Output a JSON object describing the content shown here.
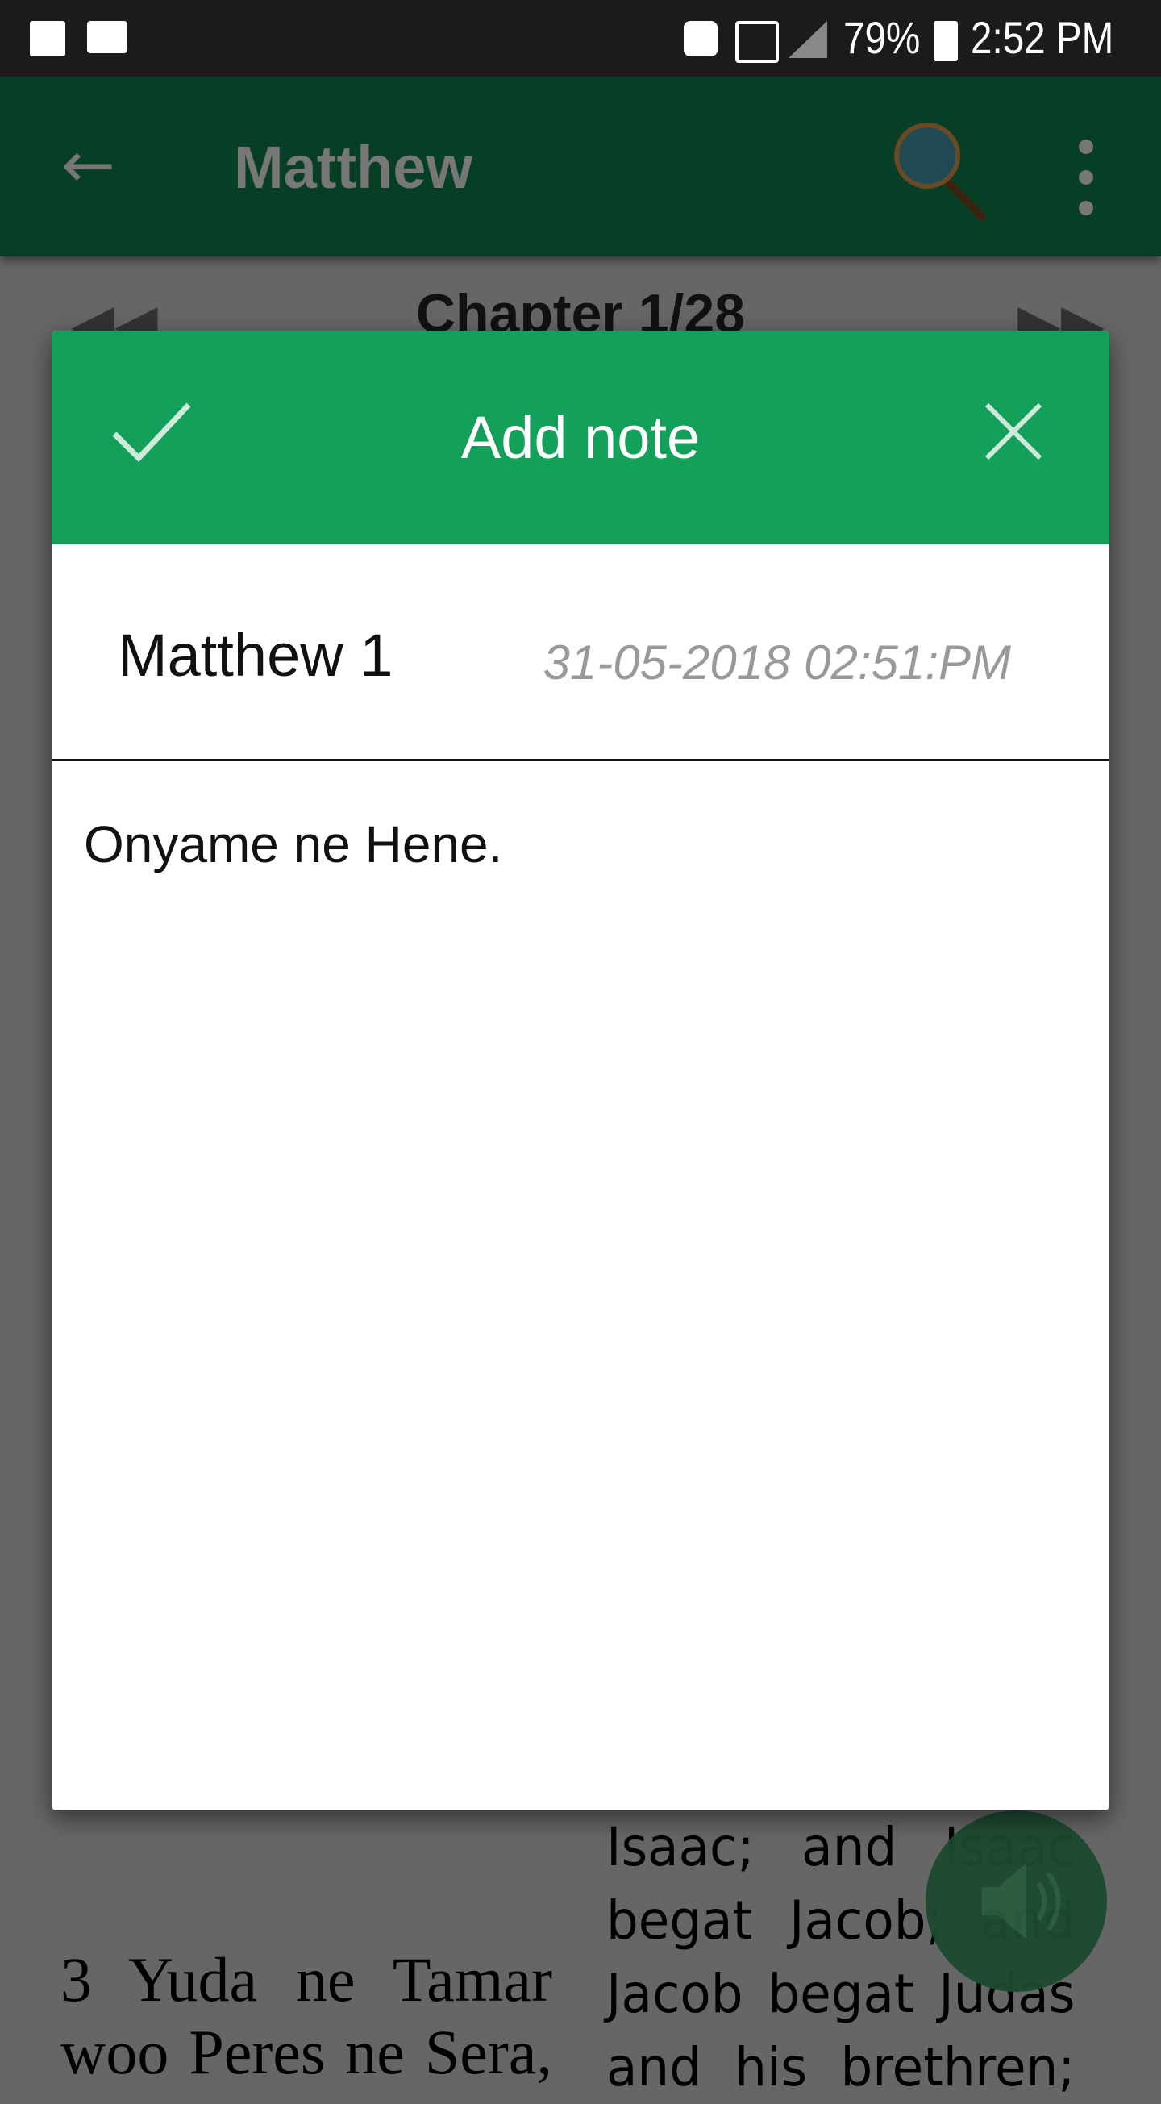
{
  "status_bar": {
    "battery": "79%",
    "time": "2:52 PM",
    "icons": [
      "image-icon",
      "message-icon",
      "call-icon",
      "signal-icon",
      "signal-icon",
      "battery-charging-icon"
    ]
  },
  "toolbar": {
    "title": "Matthew",
    "icons": [
      "back-arrow-icon",
      "search-icon",
      "more-vert-icon"
    ]
  },
  "chapter": {
    "label": "Chapter 1/28"
  },
  "dialog": {
    "title": "Add note",
    "reference": "Matthew 1",
    "date": "31-05-2018 02:51:PM",
    "note_text": "Onyame ne Hene.",
    "colors": {
      "header": "#12a05a"
    }
  },
  "content": {
    "left_lines": [
      "3 Yuda ne Tamar",
      "woo Peres ne Sera,"
    ],
    "right_lines": [
      "Isaac; and Isaac",
      "begat Jacob; and",
      "Jacob begat Judas",
      "and his brethren;"
    ]
  },
  "fab": {
    "icon": "speaker-icon"
  }
}
